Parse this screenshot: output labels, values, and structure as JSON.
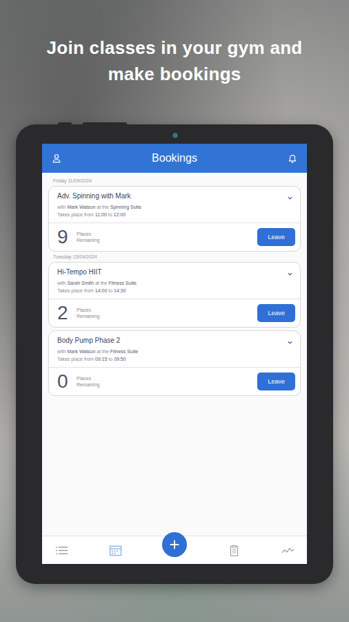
{
  "headline": "Join classes in your gym and make bookings",
  "app": {
    "title": "Bookings"
  },
  "labels": {
    "with": "with",
    "at": "at the",
    "time": "Takes place from",
    "to": "to",
    "places": "Places",
    "remaining": "Remaining"
  },
  "groups": [
    {
      "date": "Friday 11/09/2024",
      "bookings": [
        {
          "title": "Adv. Spinning with Mark",
          "instructor": "Mark Watson",
          "location": "Spinning Suite",
          "start": "11:00",
          "end": "12:00",
          "places": "9",
          "button": "Leave"
        }
      ]
    },
    {
      "date": "Tuesday 15/09/2024",
      "bookings": [
        {
          "title": "Hi-Tempo HIIT",
          "instructor": "Sarah Smith",
          "location": "Fitness Suite",
          "start": "14:00",
          "end": "14:30",
          "places": "2",
          "button": "Leave"
        },
        {
          "title": "Body Pump Phase 2",
          "instructor": "Mark Watson",
          "location": "Fitness Suite",
          "start": "09:15",
          "end": "09:50",
          "places": "0",
          "button": "Leave"
        }
      ]
    }
  ],
  "nav": [
    {
      "kind": "list",
      "selected": false
    },
    {
      "kind": "calendar",
      "selected": true
    },
    {
      "kind": "add",
      "selected": false
    },
    {
      "kind": "clipboard",
      "selected": false
    },
    {
      "kind": "chart",
      "selected": false
    }
  ]
}
